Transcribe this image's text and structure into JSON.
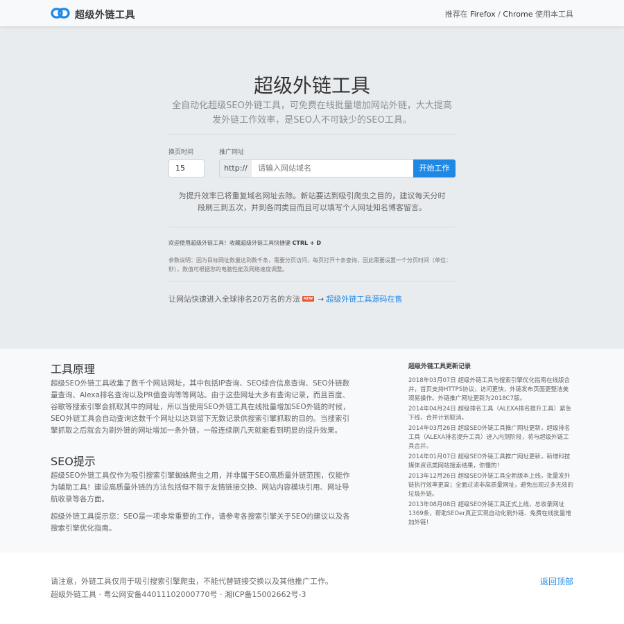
{
  "navbar": {
    "brand": "超级外链工具",
    "recommend_prefix": "推荐在",
    "browser1": "Firefox",
    "separator": "/",
    "browser2": "Chrome",
    "recommend_suffix": "使用本工具"
  },
  "hero": {
    "title": "超级外链工具",
    "lead": "全自动化超级SEO外链工具，可免费在线批量增加网站外链，大大提高发外链工作效率，是SEO人不可缺少的SEO工具。",
    "interval_label": "换页时间",
    "interval_value": "15",
    "url_label": "推广网址",
    "url_prefix": "http://",
    "url_placeholder": "请输入网站域名",
    "start_button": "开始工作",
    "notice": "为提升效率已将重复域名网址去除。新站要达到吸引爬虫之目的，建议每天分时段刷三到五次，并到各同类目而且可以填写个人网址知名博客留言。",
    "welcome_text": "欢迎使用超级外链工具！收藏超级外链工具快捷键",
    "shortcut": "CTRL + D",
    "param_note": "参数说明：因为目标网址数量达到数千条，需要分页访问，每页打开十条查询，因此需要设置一个分页时间（单位：秒），数值可根据您的电脑性能及网络速度调整。",
    "promo_text": "让网站快速进入全球排名20万名的方法",
    "new_badge": "NEW",
    "arrow": "→",
    "promo_link": "超级外链工具源码在售"
  },
  "content": {
    "principle_title": "工具原理",
    "principle_text": "超级SEO外链工具收集了数千个网站网址，其中包括IP查询、SEO综合信息查询、SEO外链数量查询、Alexa排名查询以及PR值查询等等网站。由于这些网址大多有查询记录，而且百度、谷歌等搜索引擎会抓取其中的网址，所以当使用SEO外链工具在线批量增加SEO外链的时候，SEO外链工具会自动查询这数千个网址以达到留下无数记录供搜索引擎抓取的目的。当搜索引擎抓取之后就会为刷外链的网址增加一条外链，一般连续刷几天就能看到明显的提升效果。",
    "tips_title": "SEO提示",
    "tips_text_1": "超级SEO外链工具仅作为吸引搜索引擎蜘蛛爬虫之用，并非属于SEO高质量外链范围，仅能作为辅助工具！建设高质量外链的方法包括但不限于友情链接交换、网站内容模块引用、网址导航收录等各方面。",
    "tips_text_2": "超级外链工具提示您：SEO是一项非常重要的工作，请参考各搜索引擎关于SEO的建议以及各搜索引擎优化指南。"
  },
  "sidebar": {
    "title": "超级外链工具更新记录",
    "updates": [
      "2018年03月07日 超级外链工具与搜索引擎优化指南在线版合并，首页支持HTTPS协议，访问更快，外链发布页面更整洁美观易操作。外链推广网址更新为2018C7版。",
      "2014年04月24日 超级排名工具（ALEXA排名提升工具）紧急下线，合并计划取消。",
      "2014年03月26日 超级SEO外链工具推广网址更新，超级排名工具（ALEXA排名提升工具）进入内测阶段，将与超级外链工具合并。",
      "2014年01月07日 超级SEO外链工具推广网址更新，新增科技媒体资讯类网站搜索结果，你懂的！",
      "2013年12月26日 超级SEO外链工具全新版本上线，批量发外链执行效率更高；全面过滤非高质量网址，避免出现过多无效的垃圾外链。",
      "2013年08月08日 超级SEO外链工具正式上线，总收录网址1369条，帮助SEOer真正实现自动化刷外链、免费在线批量增加外链！"
    ]
  },
  "footer": {
    "disclaimer": "请注意，外链工具仅用于吸引搜索引擎爬虫，不能代替链接交换以及其他推广工作。",
    "icp": "超级外链工具 · 粤公网安备44011102000770号 · 湘ICP备15002662号-3",
    "back_to_top": "返回顶部"
  },
  "colors": {
    "accent": "#1e88e5",
    "hero_bg": "#e9ecef",
    "badge": "#e4572e"
  }
}
